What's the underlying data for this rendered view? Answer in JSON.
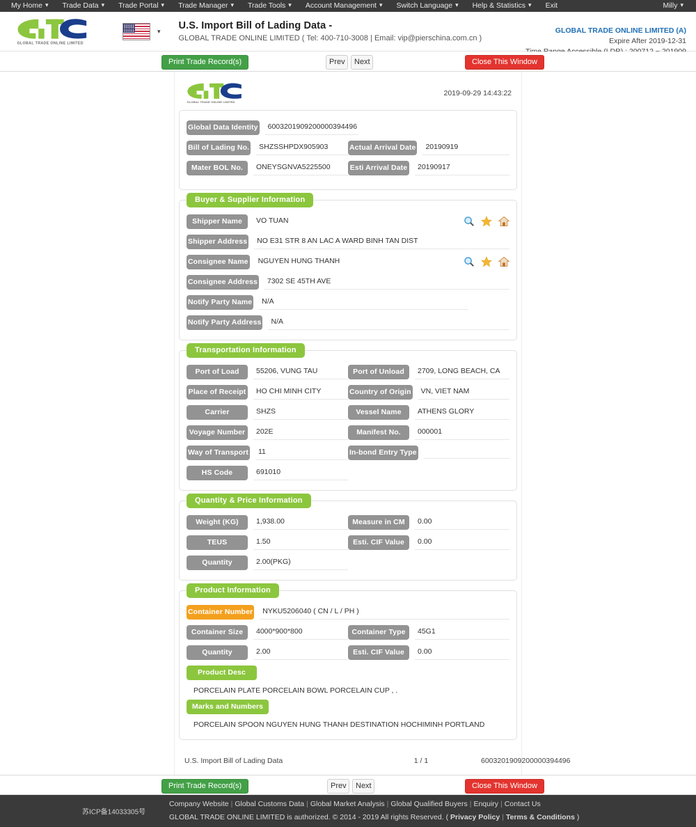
{
  "topnav": {
    "items": [
      {
        "label": "My Home",
        "caret": true
      },
      {
        "label": "Trade Data",
        "caret": true
      },
      {
        "label": "Trade Portal",
        "caret": true
      },
      {
        "label": "Trade Manager",
        "caret": true
      },
      {
        "label": "Trade Tools",
        "caret": true
      },
      {
        "label": "Account Management",
        "caret": true
      },
      {
        "label": "Switch Language",
        "caret": true
      },
      {
        "label": "Help & Statistics",
        "caret": true
      },
      {
        "label": "Exit",
        "caret": false
      }
    ],
    "user": "Milly",
    "user_caret": "▾"
  },
  "header": {
    "logo_text": "GLOBAL TRADE ONLINE LIMITED",
    "flag": "us-flag-icon",
    "title": "U.S. Import Bill of Lading Data  -",
    "subtitle": "GLOBAL TRADE ONLINE LIMITED ( Tel: 400-710-3008 | Email: vip@pierschina.com.cn )",
    "account_name": "GLOBAL TRADE ONLINE LIMITED (A)",
    "expire": "Expire After 2019-12-31",
    "time_range": "Time Range Accessible (LDR) : 200712 ~ 201909"
  },
  "actionbar": {
    "print_label": "Print Trade Record(s)",
    "prev_label": "Prev",
    "next_label": "Next",
    "close_label": "Close This Window"
  },
  "sheet": {
    "timestamp": "2019-09-29 14:43:22",
    "identity": {
      "global_data_identity_label": "Global Data Identity",
      "global_data_identity_value": "6003201909200000394496",
      "bol_label": "Bill of Lading No.",
      "bol_value": "SHZSSHPDX905903",
      "actual_arrival_label": "Actual Arrival Date",
      "actual_arrival_value": "20190919",
      "master_bol_label": "Mater BOL No.",
      "master_bol_value": "ONEYSGNVA5225500",
      "esti_arrival_label": "Esti Arrival Date",
      "esti_arrival_value": "20190917"
    },
    "buyer_supplier": {
      "title": "Buyer & Supplier Information",
      "shipper_name_label": "Shipper Name",
      "shipper_name_value": "VO TUAN",
      "shipper_address_label": "Shipper Address",
      "shipper_address_value": "NO E31 STR 8 AN LAC A WARD BINH TAN DIST",
      "consignee_name_label": "Consignee Name",
      "consignee_name_value": "NGUYEN HUNG THANH",
      "consignee_address_label": "Consignee Address",
      "consignee_address_value": "7302 SE 45TH AVE",
      "notify_name_label": "Notify Party Name",
      "notify_name_value": "N/A",
      "notify_address_label": "Notify Party Address",
      "notify_address_value": "N/A",
      "icons": [
        "search-icon",
        "star-icon",
        "home-icon"
      ]
    },
    "transportation": {
      "title": "Transportation Information",
      "port_of_load_label": "Port of Load",
      "port_of_load_value": "55206, VUNG TAU",
      "port_of_unload_label": "Port of Unload",
      "port_of_unload_value": "2709, LONG BEACH, CA",
      "place_of_receipt_label": "Place of Receipt",
      "place_of_receipt_value": "HO CHI MINH CITY",
      "country_of_origin_label": "Country of Origin",
      "country_of_origin_value": "VN, VIET NAM",
      "carrier_label": "Carrier",
      "carrier_value": "SHZS",
      "vessel_name_label": "Vessel Name",
      "vessel_name_value": "ATHENS GLORY",
      "voyage_number_label": "Voyage Number",
      "voyage_number_value": "202E",
      "manifest_no_label": "Manifest No.",
      "manifest_no_value": "000001",
      "way_of_transport_label": "Way of Transport",
      "way_of_transport_value": "11",
      "inbond_entry_type_label": "In-bond Entry Type",
      "inbond_entry_type_value": "",
      "hs_code_label": "HS Code",
      "hs_code_value": "691010"
    },
    "quantity_price": {
      "title": "Quantity & Price Information",
      "weight_label": "Weight (KG)",
      "weight_value": "1,938.00",
      "measure_label": "Measure in CM",
      "measure_value": "0.00",
      "teus_label": "TEUS",
      "teus_value": "1.50",
      "cif_label": "Esti. CIF Value",
      "cif_value": "0.00",
      "quantity_label": "Quantity",
      "quantity_value": "2.00(PKG)"
    },
    "product": {
      "title": "Product Information",
      "container_number_label": "Container Number",
      "container_number_value": "NYKU5206040 ( CN / L / PH )",
      "container_size_label": "Container Size",
      "container_size_value": "4000*900*800",
      "container_type_label": "Container Type",
      "container_type_value": "45G1",
      "quantity_label": "Quantity",
      "quantity_value": "2.00",
      "cif_label": "Esti. CIF Value",
      "cif_value": "0.00",
      "product_desc_label": "Product Desc",
      "product_desc_value": "PORCELAIN PLATE PORCELAIN BOWL PORCELAIN CUP , .",
      "marks_label": "Marks and Numbers",
      "marks_value": "PORCELAIN SPOON NGUYEN HUNG THANH DESTINATION HOCHIMINH PORTLAND"
    },
    "footer": {
      "left": "U.S. Import Bill of Lading Data",
      "page": "1 / 1",
      "right": "6003201909200000394496"
    }
  },
  "footer": {
    "icp": "苏ICP备14033305号",
    "links": [
      "Company Website",
      "Global Customs Data",
      "Global Market Analysis",
      "Global Qualified Buyers",
      "Enquiry",
      "Contact Us"
    ],
    "copyright_pre": "GLOBAL TRADE ONLINE LIMITED is authorized. © 2014 - 2019 All rights Reserved.  (",
    "privacy": "Privacy Policy",
    "terms": "Terms & Conditions",
    "copyright_post": ")"
  },
  "colors": {
    "nav_bg": "#3a3a3a",
    "accent_green": "#8cc63e",
    "pill_gray": "#939393",
    "pill_orange": "#f4a01e",
    "btn_green": "#43a047",
    "btn_red": "#e3342f",
    "link_blue": "#1f6fb5"
  }
}
